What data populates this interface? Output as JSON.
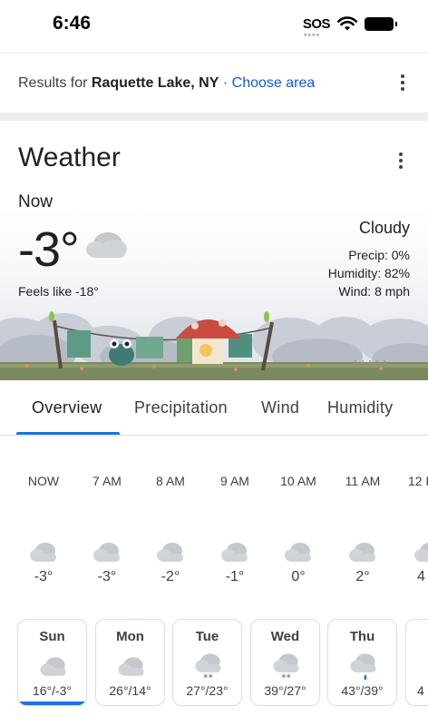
{
  "status_bar": {
    "time": "6:46",
    "sos": "SOS"
  },
  "results": {
    "prefix": "Results for",
    "location": "Raquette Lake, NY",
    "separator": "·",
    "choose_area": "Choose area"
  },
  "weather": {
    "title": "Weather",
    "now_label": "Now",
    "temperature": "-3°",
    "feels_like": "Feels like -18°",
    "condition": "Cloudy",
    "precip": "Precip: 0%",
    "humidity": "Humidity: 82%",
    "wind": "Wind: 8 mph"
  },
  "tabs": [
    "Overview",
    "Precipitation",
    "Wind",
    "Humidity"
  ],
  "hourly": [
    {
      "time": "NOW",
      "temp": "-3°",
      "icon": "cloud-icon"
    },
    {
      "time": "7 AM",
      "temp": "-3°",
      "icon": "cloud-icon"
    },
    {
      "time": "8 AM",
      "temp": "-2°",
      "icon": "cloud-icon"
    },
    {
      "time": "9 AM",
      "temp": "-1°",
      "icon": "cloud-icon"
    },
    {
      "time": "10 AM",
      "temp": "0°",
      "icon": "cloud-icon"
    },
    {
      "time": "11 AM",
      "temp": "2°",
      "icon": "cloud-icon"
    },
    {
      "time": "12 P",
      "temp": "4",
      "icon": "cloud-icon"
    }
  ],
  "daily": [
    {
      "day": "Sun",
      "range": "16°/-3°",
      "icon": "cloud-icon"
    },
    {
      "day": "Mon",
      "range": "26°/14°",
      "icon": "cloud-icon"
    },
    {
      "day": "Tue",
      "range": "27°/23°",
      "icon": "snow-cloud-icon"
    },
    {
      "day": "Wed",
      "range": "39°/27°",
      "icon": "snow-cloud-icon"
    },
    {
      "day": "Thu",
      "range": "43°/39°",
      "icon": "rain-cloud-icon"
    },
    {
      "day": "",
      "range": "4",
      "icon": ""
    }
  ],
  "colors": {
    "accent": "#1a73e8",
    "link": "#1558d6",
    "text": "#202124",
    "secondary_text": "#3c4043"
  }
}
